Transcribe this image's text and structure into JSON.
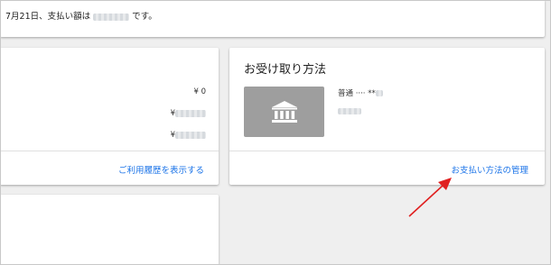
{
  "notice": {
    "text_before": "7月21日、支払い額は",
    "text_after": "です。"
  },
  "balance_card": {
    "amounts": [
      {
        "currency": "¥",
        "value": "0"
      },
      {
        "currency": "¥",
        "value": ""
      },
      {
        "currency": "¥",
        "value": ""
      }
    ],
    "link_label": "ご利用履歴を表示する"
  },
  "receive_card": {
    "title": "お受け取り方法",
    "account_type": "普通 ····",
    "account_number_suffix": "**",
    "link_label": "お支払い方法の管理",
    "bank_icon": "bank-building-icon"
  },
  "annotation": {
    "arrow_color": "#e02020"
  },
  "colors": {
    "background": "#efefef",
    "card": "#ffffff",
    "link": "#1a73e8",
    "tile": "#9e9e9e"
  }
}
